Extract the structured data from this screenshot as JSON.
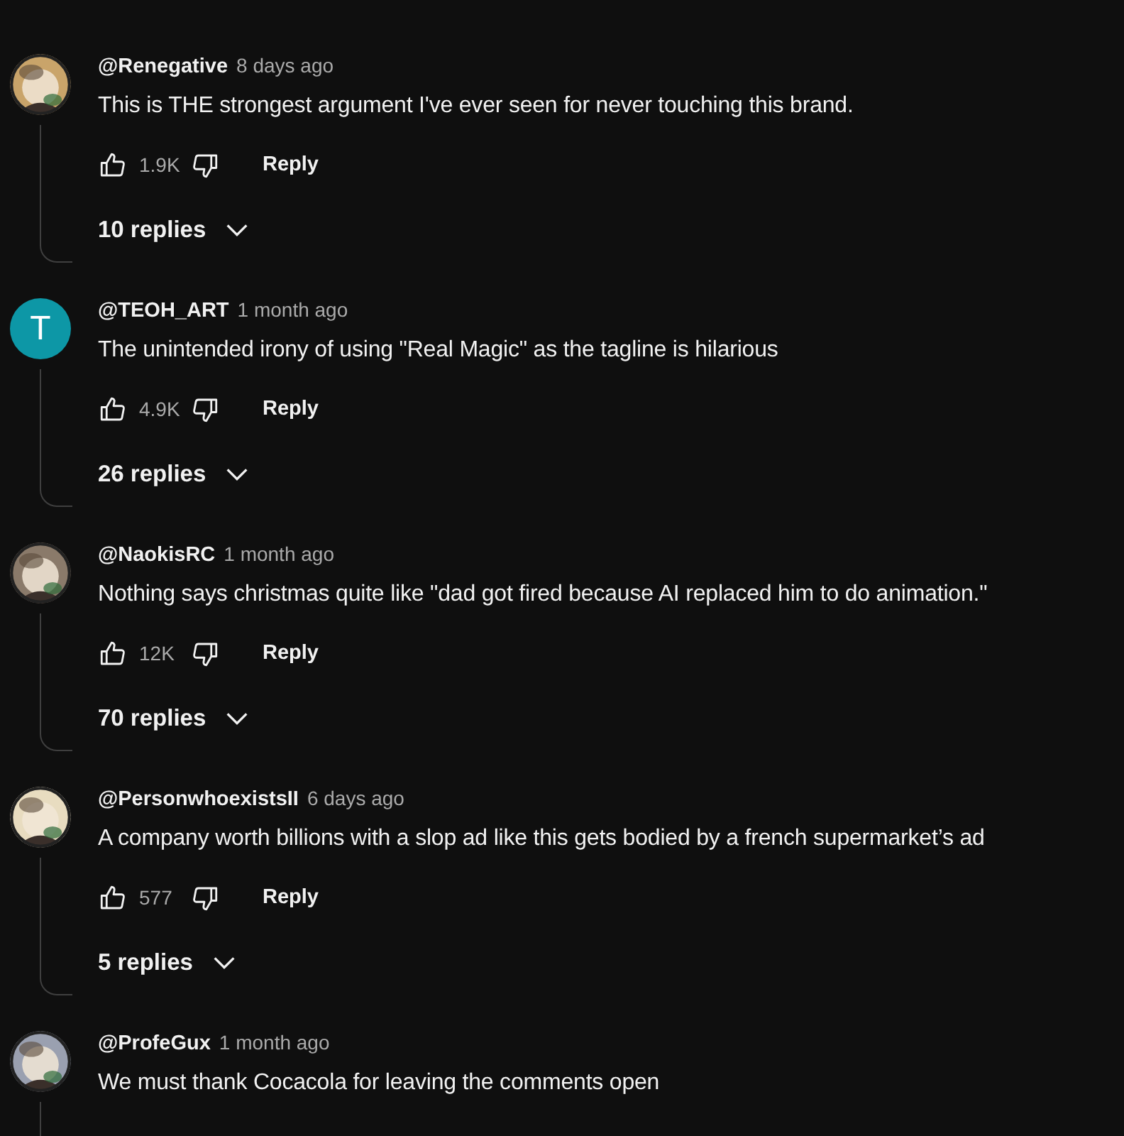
{
  "comments": [
    {
      "author": "@Renegative",
      "time": "8 days ago",
      "text": "This is THE strongest argument I've ever seen for never touching this brand.",
      "likes": "1.9K",
      "reply_label": "Reply",
      "replies_label": "10 replies"
    },
    {
      "author": "@TEOH_ART",
      "time": "1 month ago",
      "text": "The unintended irony of using \"Real Magic\" as the tagline is hilarious",
      "avatar": {
        "kind": "letter",
        "letter": "T",
        "color": "#0d97a6"
      },
      "likes": "4.9K",
      "reply_label": "Reply",
      "replies_label": "26 replies"
    },
    {
      "author": "@NaokisRC",
      "time": "1 month ago",
      "text": "Nothing says christmas quite like \"dad got fired because AI replaced him to do animation.\"",
      "likes": "12K",
      "reply_label": "Reply",
      "replies_label": "70 replies"
    },
    {
      "author": "@PersonwhoexistsII",
      "time": "6 days ago",
      "text": "A company worth billions with a slop ad like this gets bodied by a french supermarket’s ad",
      "likes": "577",
      "reply_label": "Reply",
      "replies_label": "5 replies"
    },
    {
      "author": "@ProfeGux",
      "time": "1 month ago",
      "text": "We must thank Cocacola for leaving the comments open"
    }
  ]
}
